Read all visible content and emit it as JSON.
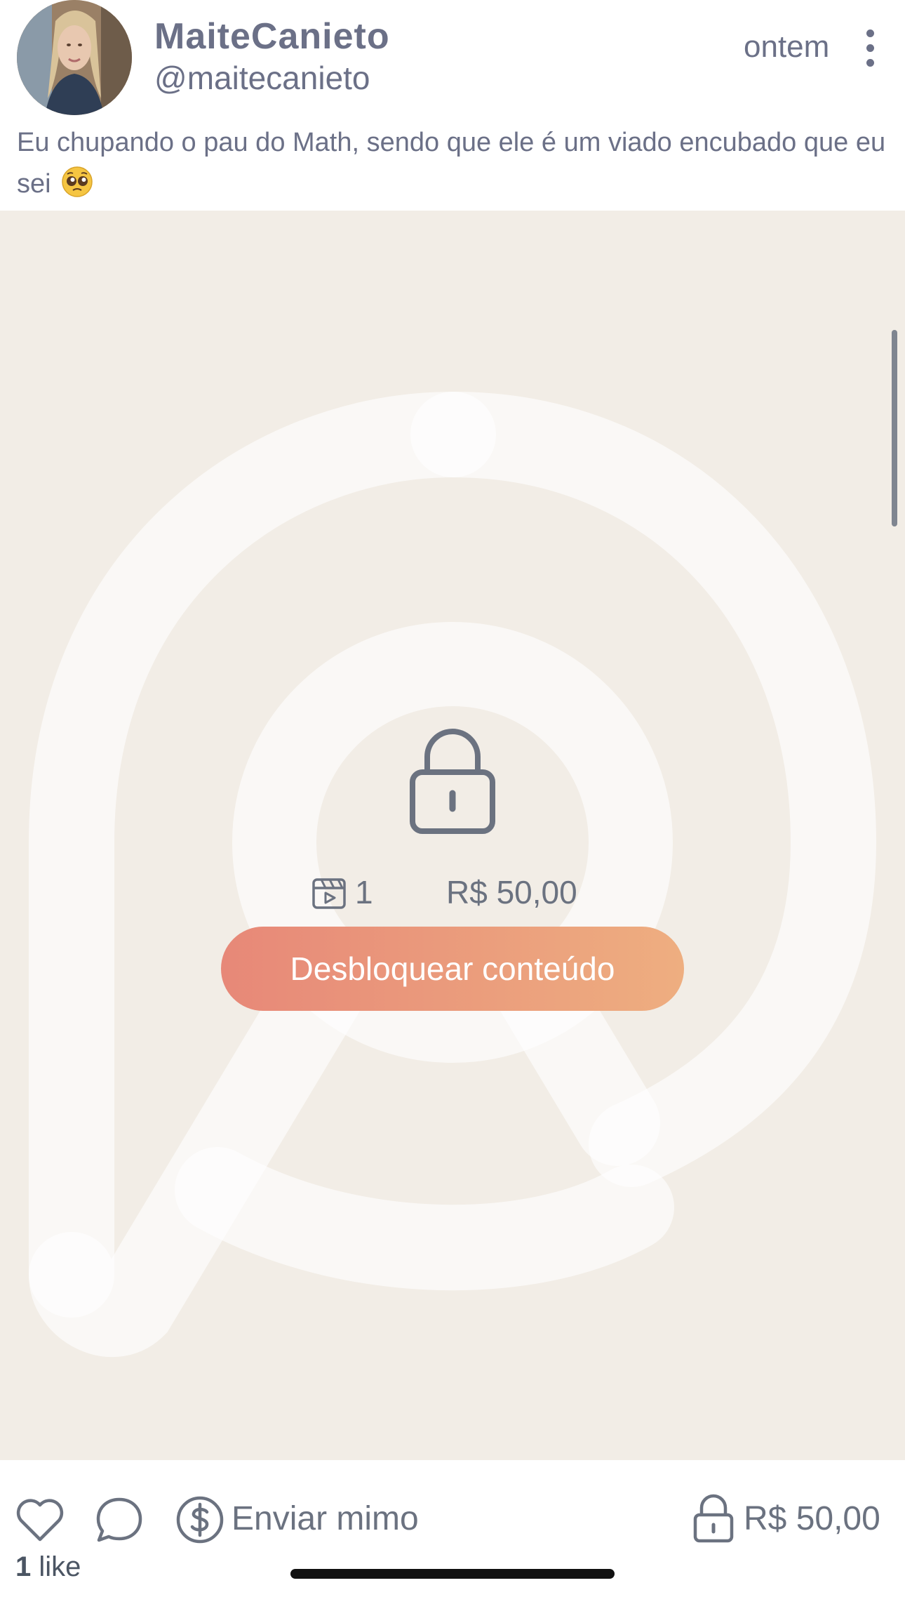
{
  "post": {
    "display_name": "MaiteCanieto",
    "handle": "@maitecanieto",
    "timestamp": "ontem",
    "caption": "Eu chupando o pau do Math, sendo que ele é um viado encubado que eu sei"
  },
  "locked_media": {
    "media_count": "1",
    "price": "R$ 50,00",
    "unlock_label": "Desbloquear conteúdo"
  },
  "actions": {
    "tip_label": "Enviar mimo",
    "price": "R$ 50,00",
    "likes_count": "1",
    "likes_word": "like"
  },
  "icons": [
    "avatar",
    "more-vertical-icon",
    "pleading-face-emoji",
    "lock-icon",
    "clapperboard-icon",
    "heart-icon",
    "comment-icon",
    "dollar-coin-icon",
    "lock-icon"
  ],
  "colors": {
    "media_bg": "#f2ede6",
    "button_gradient_start": "#e78878",
    "button_gradient_end": "#eeae80",
    "text_gray": "#6b7087"
  }
}
